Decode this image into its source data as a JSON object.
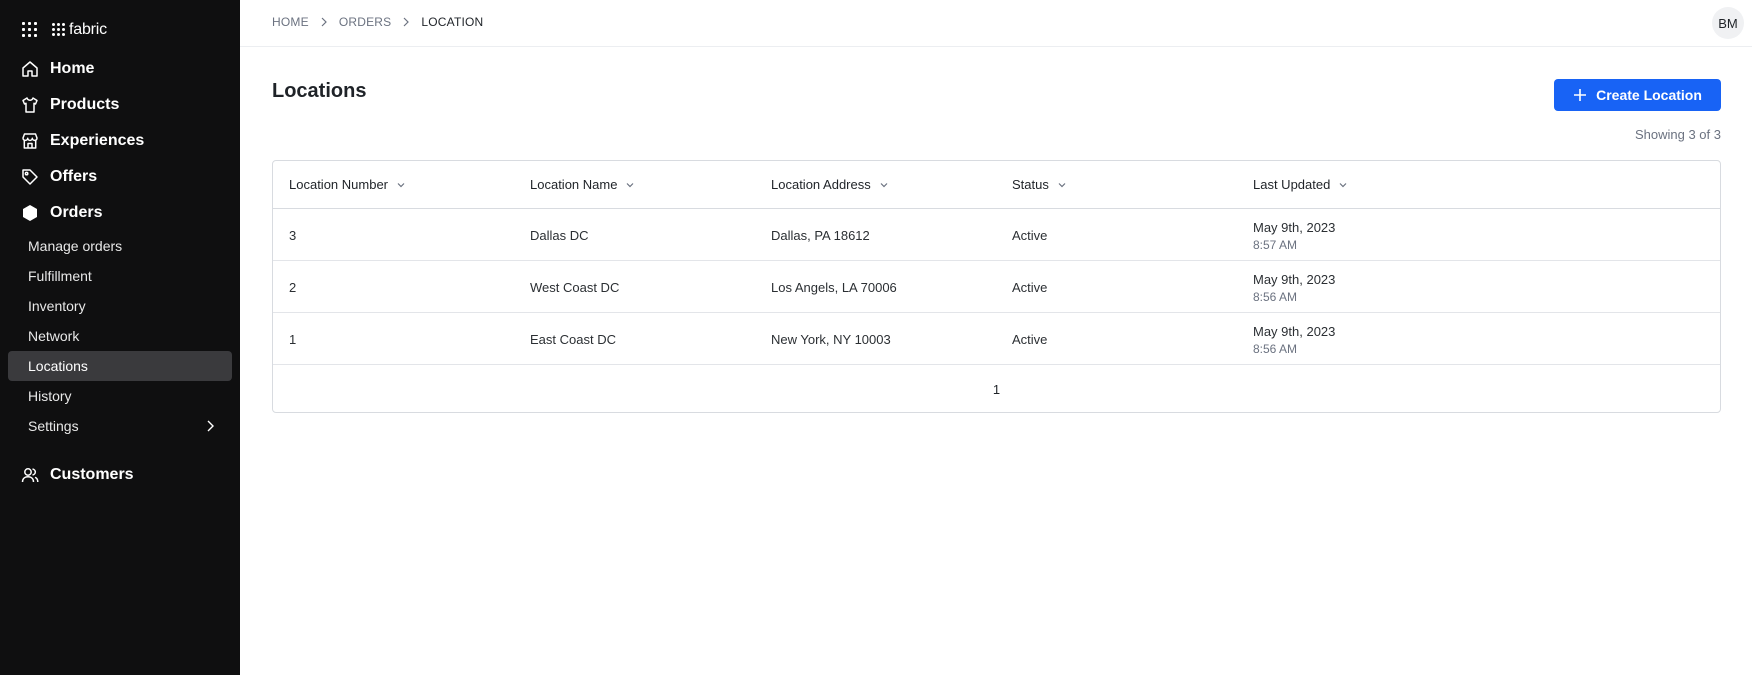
{
  "app": {
    "brand": "fabric"
  },
  "sidebar": {
    "main_top": [
      {
        "label": "Home",
        "icon": "home-icon"
      },
      {
        "label": "Products",
        "icon": "shirt-icon"
      },
      {
        "label": "Experiences",
        "icon": "storefront-icon"
      },
      {
        "label": "Offers",
        "icon": "tag-icon"
      },
      {
        "label": "Orders",
        "icon": "hexagon-icon"
      }
    ],
    "orders_sub": [
      {
        "label": "Manage orders"
      },
      {
        "label": "Fulfillment"
      },
      {
        "label": "Inventory"
      },
      {
        "label": "Network"
      },
      {
        "label": "Locations",
        "active": true
      },
      {
        "label": "History"
      },
      {
        "label": "Settings",
        "has_chevron": true
      }
    ],
    "main_bottom": [
      {
        "label": "Customers",
        "icon": "users-icon"
      }
    ]
  },
  "header": {
    "breadcrumb": [
      "HOME",
      "ORDERS",
      "LOCATION"
    ],
    "avatar_initials": "BM"
  },
  "page": {
    "title": "Locations",
    "create_button": "Create Location",
    "showing": "Showing 3 of 3"
  },
  "table": {
    "columns": [
      "Location Number",
      "Location Name",
      "Location Address",
      "Status",
      "Last Updated"
    ],
    "rows": [
      {
        "number": "3",
        "name": "Dallas DC",
        "address": "Dallas, PA 18612",
        "status": "Active",
        "date": "May 9th, 2023",
        "time": "8:57 AM"
      },
      {
        "number": "2",
        "name": "West Coast DC",
        "address": "Los Angels, LA 70006",
        "status": "Active",
        "date": "May 9th, 2023",
        "time": "8:56 AM"
      },
      {
        "number": "1",
        "name": "East Coast DC",
        "address": "New York, NY 10003",
        "status": "Active",
        "date": "May 9th, 2023",
        "time": "8:56 AM"
      }
    ],
    "pagination": [
      "1"
    ]
  },
  "colors": {
    "accent": "#1863f5",
    "sidebar_bg": "#0f0f10",
    "active_item_bg": "#3a3a3d"
  }
}
